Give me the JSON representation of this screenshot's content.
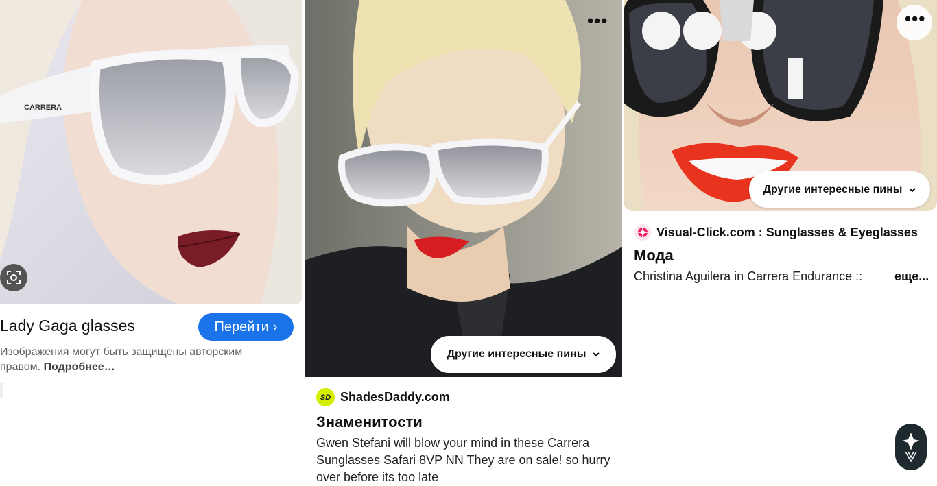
{
  "result1": {
    "title": "Lady Gaga glasses",
    "goto_label": "Перейти",
    "goto_chevron": "›",
    "copyright_text": "Изображения могут быть защищены авторским правом.",
    "copyright_more": "Подробнее…",
    "lens_icon": "google-lens-icon"
  },
  "result2": {
    "more_pins_label": "Другие интересные пины",
    "dots": "•••",
    "source": "ShadesDaddy.com",
    "logo_text": "SD",
    "board": "Знаменитости",
    "description": "Gwen Stefani will blow your mind in these Carrera Sunglasses Safari 8VP NN They are on sale! so hurry over before its too late"
  },
  "result3": {
    "more_pins_label": "Другие интересные пины",
    "dots": "•••",
    "source": "Visual-Click.com : Sunglasses & Eyeglasses",
    "board": "Мода",
    "description": "Christina Aguilera in Carrera Endurance ::",
    "more_link": "еще..."
  },
  "colors": {
    "accent": "#1a73e8",
    "shadesdaddy_logo": "#d4f000",
    "fab_bg": "#1f2a2f"
  }
}
